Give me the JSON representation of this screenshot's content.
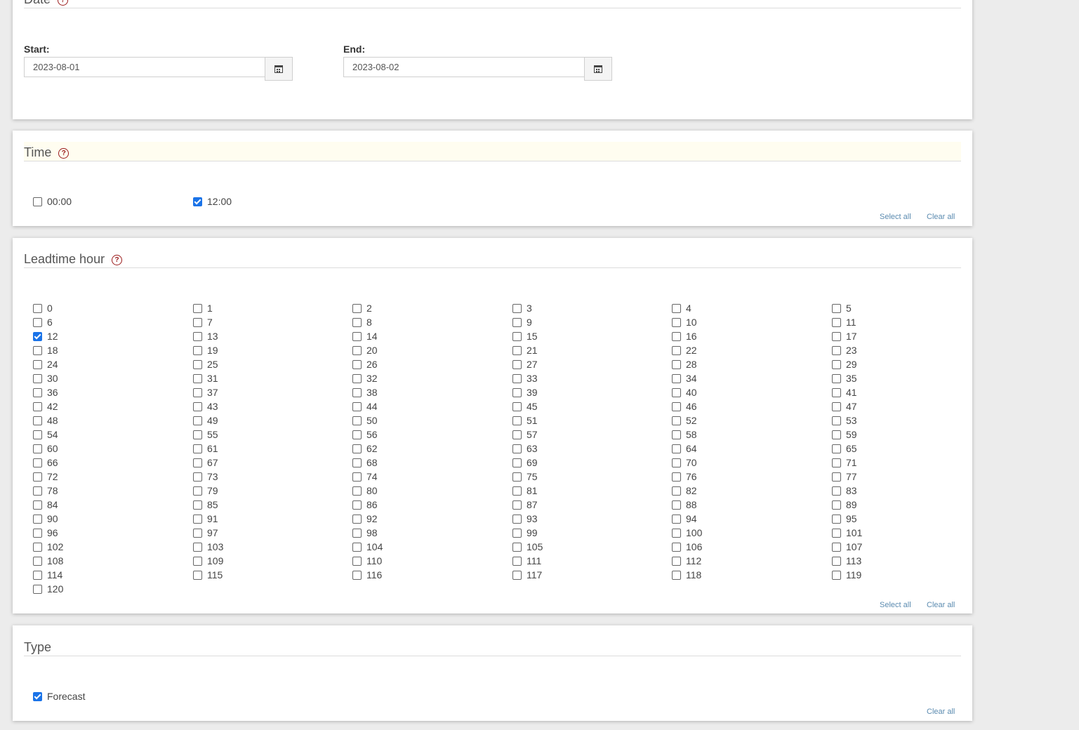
{
  "date": {
    "title": "Date",
    "help": "?",
    "start_label": "Start:",
    "start_value": "2023-08-01",
    "end_label": "End:",
    "end_value": "2023-08-02"
  },
  "time": {
    "title": "Time",
    "help": "?",
    "options": [
      {
        "label": "00:00",
        "checked": false
      },
      {
        "label": "12:00",
        "checked": true
      }
    ],
    "select_all": "Select all",
    "clear_all": "Clear all"
  },
  "leadtime": {
    "title": "Leadtime hour",
    "help": "?",
    "checked": [
      "12"
    ],
    "options": [
      "0",
      "1",
      "2",
      "3",
      "4",
      "5",
      "6",
      "7",
      "8",
      "9",
      "10",
      "11",
      "12",
      "13",
      "14",
      "15",
      "16",
      "17",
      "18",
      "19",
      "20",
      "21",
      "22",
      "23",
      "24",
      "25",
      "26",
      "27",
      "28",
      "29",
      "30",
      "31",
      "32",
      "33",
      "34",
      "35",
      "36",
      "37",
      "38",
      "39",
      "40",
      "41",
      "42",
      "43",
      "44",
      "45",
      "46",
      "47",
      "48",
      "49",
      "50",
      "51",
      "52",
      "53",
      "54",
      "55",
      "56",
      "57",
      "58",
      "59",
      "60",
      "61",
      "62",
      "63",
      "64",
      "65",
      "66",
      "67",
      "68",
      "69",
      "70",
      "71",
      "72",
      "73",
      "74",
      "75",
      "76",
      "77",
      "78",
      "79",
      "80",
      "81",
      "82",
      "83",
      "84",
      "85",
      "86",
      "87",
      "88",
      "89",
      "90",
      "91",
      "92",
      "93",
      "94",
      "95",
      "96",
      "97",
      "98",
      "99",
      "100",
      "101",
      "102",
      "103",
      "104",
      "105",
      "106",
      "107",
      "108",
      "109",
      "110",
      "111",
      "112",
      "113",
      "114",
      "115",
      "116",
      "117",
      "118",
      "119",
      "120"
    ],
    "select_all": "Select all",
    "clear_all": "Clear all"
  },
  "type": {
    "title": "Type",
    "options": [
      {
        "label": "Forecast",
        "checked": true
      }
    ],
    "clear_all": "Clear all"
  },
  "colors": {
    "accent": "#1a73e8",
    "help_icon": "#9b1c1c",
    "link": "#5b8bb0"
  },
  "icons": {
    "help": "question-circle-icon",
    "calendar": "calendar-icon"
  }
}
